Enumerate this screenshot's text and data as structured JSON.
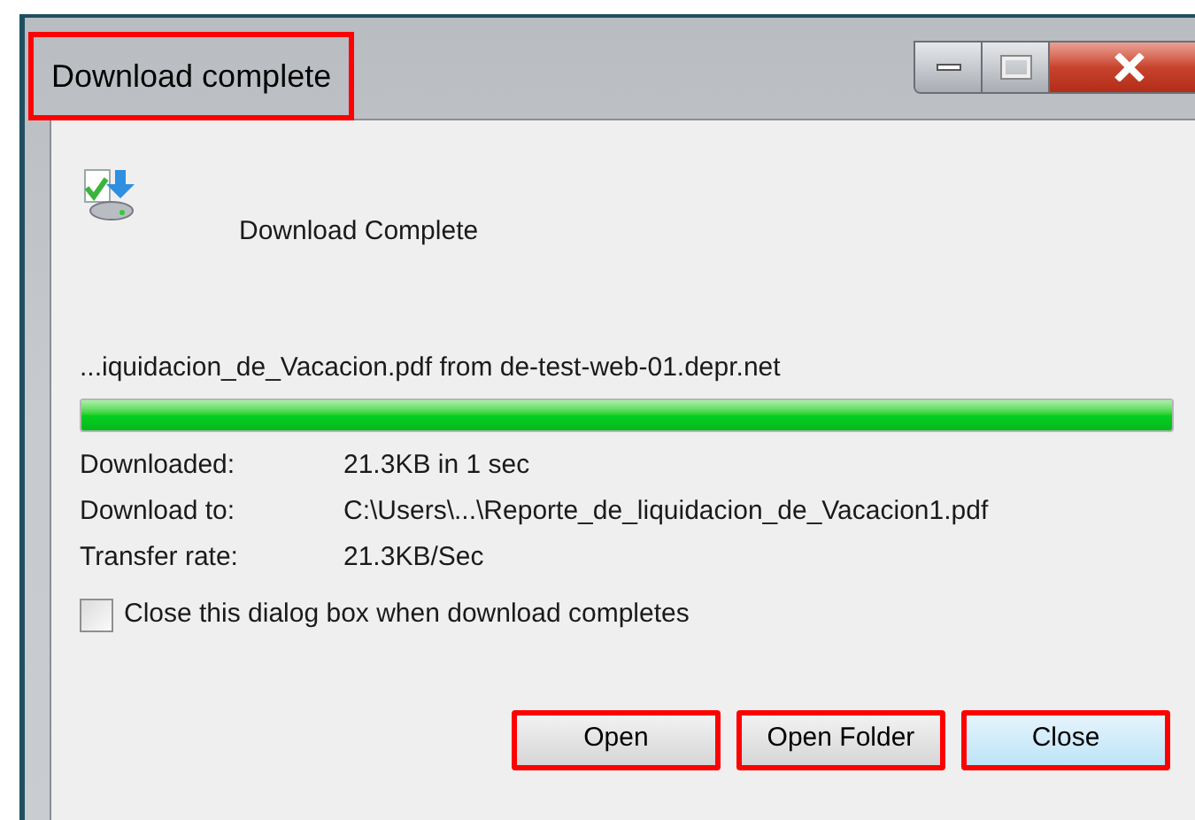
{
  "window": {
    "title": "Download complete",
    "title_highlighted": true
  },
  "heading": "Download Complete",
  "source": "...iquidacion_de_Vacacion.pdf from de-test-web-01.depr.net",
  "progress": {
    "level": 1
  },
  "details": [
    {
      "label": "Downloaded:",
      "value": "21.3KB in 1 sec"
    },
    {
      "label": "Download to:",
      "value": "C:\\Users\\...\\Reporte_de_liquidacion_de_Vacacion1.pdf"
    },
    {
      "label": "Transfer rate:",
      "value": "21.3KB/Sec"
    }
  ],
  "close_when_done": {
    "label": "Close this dialog box when download completes",
    "checked": false
  },
  "buttons": [
    {
      "label": "Open",
      "default": false,
      "highlighted": true
    },
    {
      "label": "Open Folder",
      "default": false,
      "highlighted": true
    },
    {
      "label": "Close",
      "default": true,
      "highlighted": true
    }
  ]
}
